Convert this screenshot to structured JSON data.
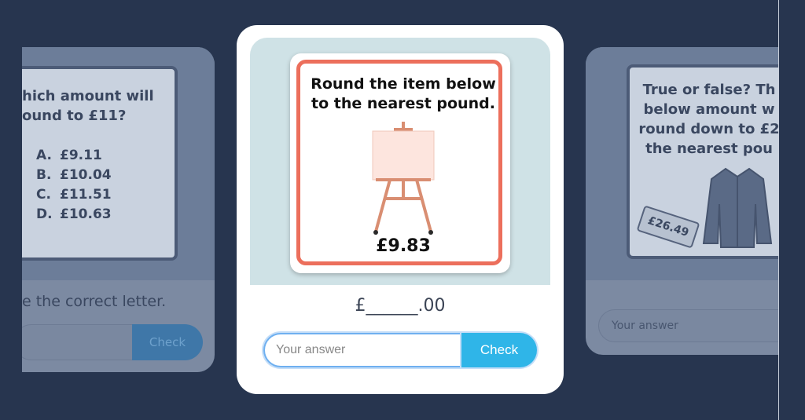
{
  "left_card": {
    "question": "hich amount will round to £11?",
    "question_line1": "hich amount will",
    "question_line2": "ound to £11?",
    "options": [
      {
        "letter": "A.",
        "value": "£9.11"
      },
      {
        "letter": "B.",
        "value": "£10.04"
      },
      {
        "letter": "C.",
        "value": "£11.51"
      },
      {
        "letter": "D.",
        "value": "£10.63"
      }
    ],
    "instruction": "e the correct letter.",
    "check_label": "Check"
  },
  "main_card": {
    "question_line1": "Round the item below",
    "question_line2": "to the nearest pound.",
    "price": "£9.83",
    "answer_prefix": "£",
    "answer_blank": "______",
    "answer_suffix": ".00",
    "input_placeholder": "Your answer",
    "check_label": "Check",
    "item_icon": "easel-icon"
  },
  "right_card": {
    "question_line1": "True or false? Th",
    "question_line2": "below amount w",
    "question_line3": "round down to £2",
    "question_line4": "the nearest pou",
    "tag_price": "£26.49",
    "input_placeholder": "Your answer",
    "item_icon": "jacket-icon"
  },
  "colors": {
    "background": "#27354f",
    "accent": "#2fb5e8",
    "frame": "#ec6f5c"
  }
}
